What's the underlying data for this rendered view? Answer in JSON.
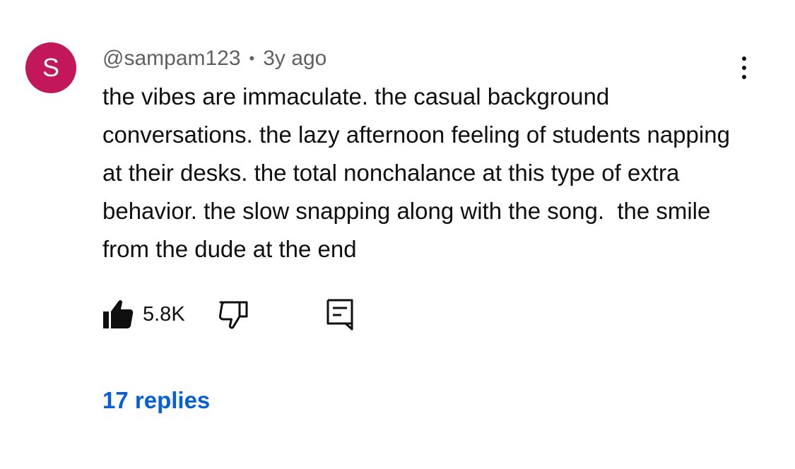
{
  "comment": {
    "avatar_letter": "S",
    "avatar_color": "#c2185b",
    "author": "@sampam123",
    "separator": "•",
    "time_ago": "3y ago",
    "text": "the vibes are immaculate. the casual background conversations. the lazy afternoon feeling of students napping at their desks. the total nonchalance at this type of extra behavior. the slow snapping along with the song.  the smile from the dude at the end",
    "like_count": "5.8K",
    "replies_label": "17 replies",
    "link_color": "#065fd4"
  },
  "icons": {
    "like": "thumbs-up-filled-icon",
    "dislike": "thumbs-down-outline-icon",
    "reply": "comment-reply-icon",
    "more": "more-vertical-icon"
  }
}
